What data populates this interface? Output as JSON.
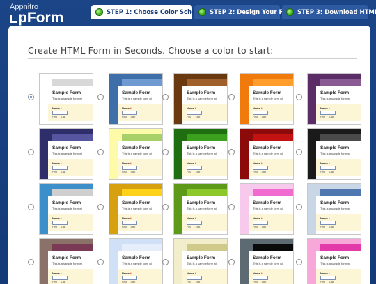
{
  "app": {
    "logo_small": "Appnitro",
    "logo_big": "pForm"
  },
  "steps": [
    {
      "label": "STEP 1: Choose Color Scheme",
      "active": true
    },
    {
      "label": "STEP 2: Design Your Form",
      "active": false
    },
    {
      "label": "STEP 3: Download HTML",
      "active": false
    }
  ],
  "main": {
    "heading": "Create HTML Form in Seconds. Choose a color to start:"
  },
  "sample_form": {
    "title": "Sample Form",
    "description": "This is a sample form wi",
    "field_label": "Name",
    "required_mark": "*",
    "sub_first": "First",
    "sub_last": "Last"
  },
  "color_schemes": [
    {
      "side": "#ffffff",
      "top": "#d8d8d8",
      "field": "#fdf6d6",
      "selected": true
    },
    {
      "side": "#3e6fa8",
      "top": "#6f9bd2",
      "field": "#fdf6d6",
      "selected": false
    },
    {
      "side": "#6a3910",
      "top": "#a0602b",
      "field": "#fdf6d6",
      "selected": false
    },
    {
      "side": "#f07a0c",
      "top": "#ff9e2c",
      "field": "#fdf6d6",
      "selected": false
    },
    {
      "side": "#5a2d66",
      "top": "#8a5a93",
      "field": "#fdf6d6",
      "selected": false
    },
    {
      "side": "#2e2e6a",
      "top": "#5656a0",
      "field": "#fdf6d6",
      "selected": false
    },
    {
      "side": "#fdfaa8",
      "top": "#a8d068",
      "field": "#fdf6d6",
      "selected": false
    },
    {
      "side": "#1f6e10",
      "top": "#3aa01e",
      "field": "#fdf6d6",
      "selected": false
    },
    {
      "side": "#8c0a0a",
      "top": "#c21212",
      "field": "#fdf6d6",
      "selected": false
    },
    {
      "side": "#1a1a1a",
      "top": "#4a4a4a",
      "field": "#fdf6d6",
      "selected": false
    },
    {
      "side": "#3d8fc9",
      "top": "#cfcfcf",
      "field": "#fdf6d6",
      "selected": false
    },
    {
      "side": "#d6a010",
      "top": "#ffd21a",
      "field": "#fdf6d6",
      "selected": false
    },
    {
      "side": "#5e9a1a",
      "top": "#8cc82a",
      "field": "#fdf6d6",
      "selected": false
    },
    {
      "side": "#f7c9ec",
      "top": "#f06ad0",
      "field": "#fdf6d6",
      "selected": false
    },
    {
      "side": "#c9d6e6",
      "top": "#4f78b0",
      "field": "#fdf6d6",
      "selected": false
    },
    {
      "side": "#8a7268",
      "top": "#7a3a55",
      "field": "#fdf6d6",
      "selected": false
    },
    {
      "side": "#cfe0f7",
      "top": "#e6eefb",
      "field": "#fdf6d6",
      "selected": false
    },
    {
      "side": "#f2eecb",
      "top": "#cfc98a",
      "field": "#fdf6d6",
      "selected": false
    },
    {
      "side": "#5e6a72",
      "top": "#0a0a0a",
      "field": "#fdf6d6",
      "selected": false
    },
    {
      "side": "#f7a8d8",
      "top": "#e23aa8",
      "field": "#fdf6d6",
      "selected": false
    }
  ]
}
